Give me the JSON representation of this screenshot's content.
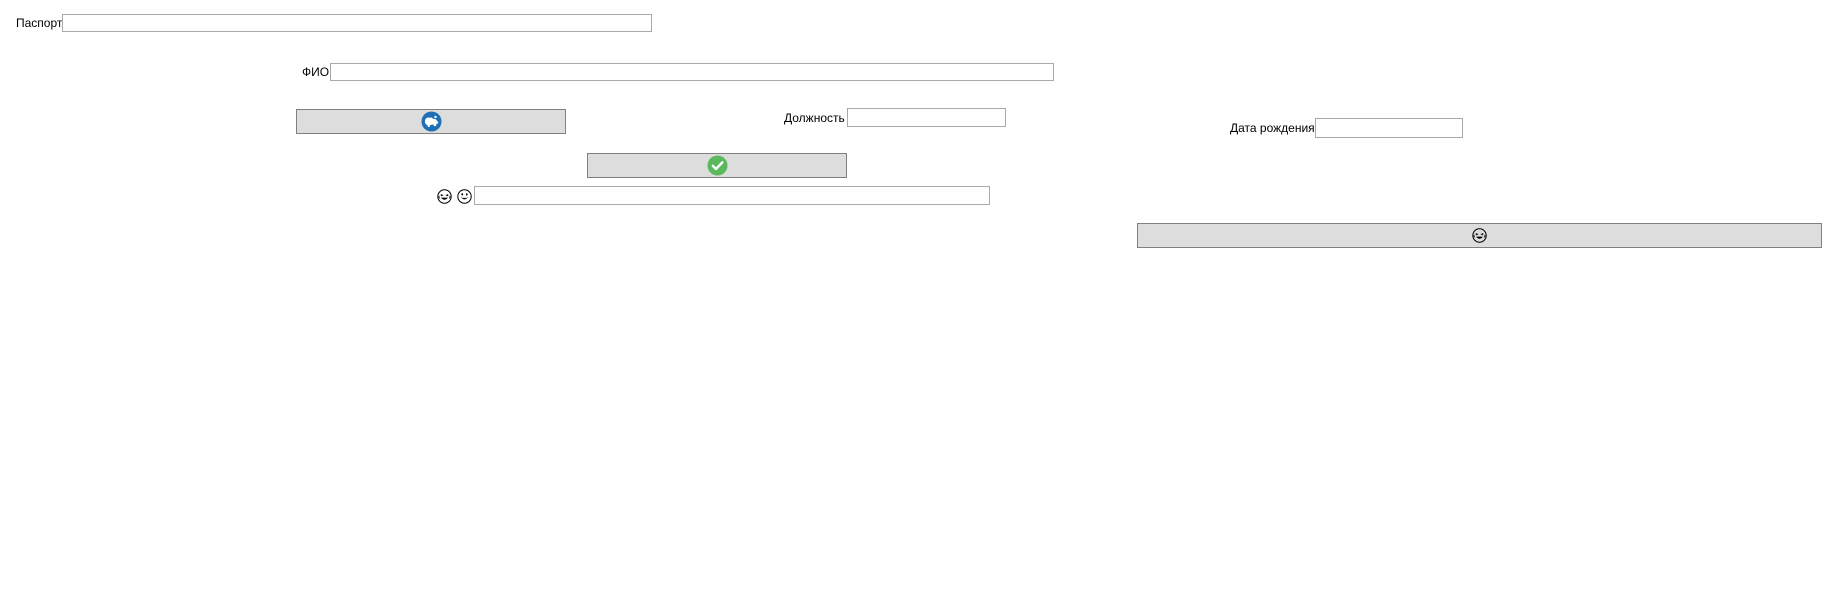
{
  "form": {
    "passport": {
      "label": "Паспорт",
      "value": ""
    },
    "fio": {
      "label": "ФИО",
      "value": ""
    },
    "position": {
      "label": "Должность",
      "value": ""
    },
    "birth_date": {
      "label": "Дата рождения",
      "value": ""
    },
    "emoji_field": {
      "value": ""
    }
  },
  "buttons": {
    "globe_button": {
      "icon": "globe-icon"
    },
    "confirm_button": {
      "icon": "check-circle-icon"
    },
    "smiley_button": {
      "icon": "laughing-face-icon"
    }
  },
  "emoji_icons": [
    "laughing-face-icon",
    "grinning-face-icon"
  ],
  "colors": {
    "button_bg": "#dddddd",
    "button_border": "#808080",
    "field_border": "#a9a9a9",
    "check_green": "#5cb85c",
    "globe_blue": "#1f6fb5"
  }
}
